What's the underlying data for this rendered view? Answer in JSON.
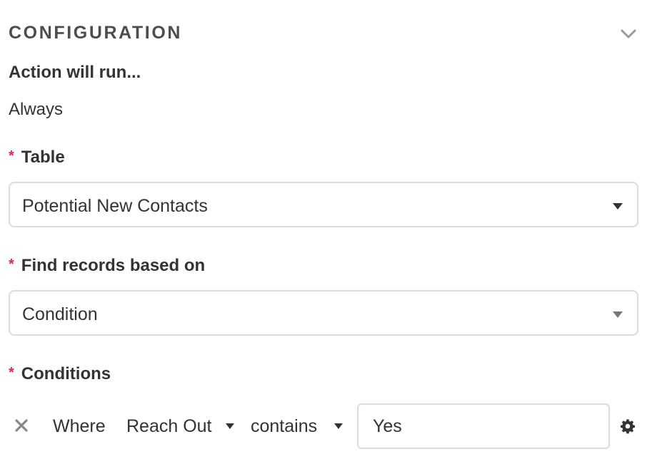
{
  "section": {
    "title": "CONFIGURATION"
  },
  "run_condition": {
    "label": "Action will run...",
    "value": "Always"
  },
  "table_field": {
    "required_marker": "*",
    "label": "Table",
    "selected": "Potential New Contacts"
  },
  "find_field": {
    "required_marker": "*",
    "label": "Find records based on",
    "selected": "Condition"
  },
  "conditions_field": {
    "required_marker": "*",
    "label": "Conditions",
    "rows": [
      {
        "prefix": "Where",
        "field": "Reach Out",
        "operator": "contains",
        "value": "Yes"
      }
    ]
  },
  "icons": {
    "collapse": "chevron-down-icon",
    "remove": "close-icon",
    "settings": "gear-icon",
    "dropdown": "caret-down-icon"
  },
  "colors": {
    "required": "#e0245e",
    "border": "#dcdcdc",
    "text": "#333333"
  }
}
